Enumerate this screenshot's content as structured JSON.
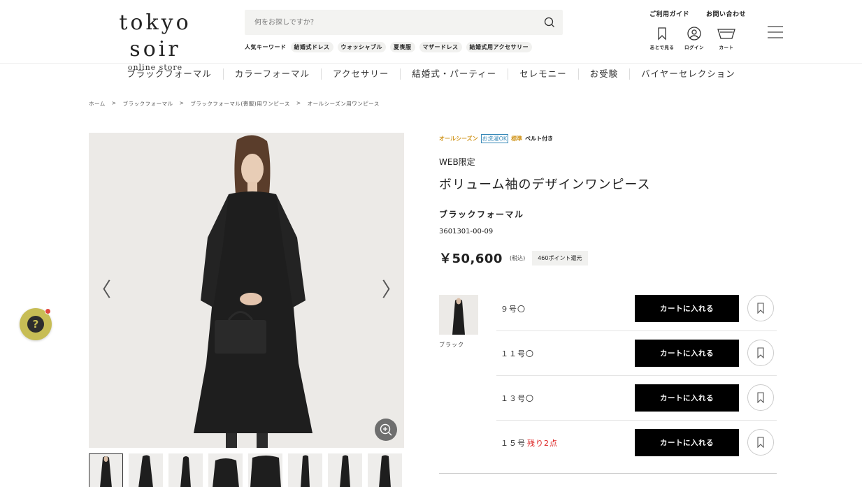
{
  "header": {
    "logo_main": "tokyo soir",
    "logo_sub": "online store",
    "search_placeholder": "何をお探しですか？",
    "keywords_label": "人気キーワード",
    "keywords": [
      "結婚式ドレス",
      "ウォッシャブル",
      "夏喪服",
      "マザードレス",
      "結婚式用アクセサリー"
    ],
    "guide_link": "ご利用ガイド",
    "contact_link": "お問い合わせ",
    "icons": [
      {
        "name": "bookmark-icon",
        "label": "あとで見る"
      },
      {
        "name": "user-icon",
        "label": "ログイン"
      },
      {
        "name": "cart-icon",
        "label": "カート"
      }
    ]
  },
  "nav": [
    "ブラックフォーマル",
    "カラーフォーマル",
    "アクセサリー",
    "結婚式・パーティー",
    "セレモニー",
    "お受験",
    "バイヤーセレクション"
  ],
  "breadcrumb": [
    "ホーム",
    ">",
    "ブラックフォーマル",
    ">",
    "ブラックフォーマル(喪服)用ワンピース",
    ">",
    "オールシーズン用ワンピース"
  ],
  "gallery": {
    "prev": "〈",
    "next": "〉",
    "thumb_count": 8
  },
  "product": {
    "tag_season": "オールシーズン",
    "tag_wash": "お洗濯OK",
    "tag_std": "標準",
    "tag_belt": "ベルト付き",
    "web_only": "WEB限定",
    "name": "ボリューム袖のデザインワンピース",
    "category": "ブラックフォーマル",
    "code": "3601301-00-09",
    "price": "￥50,600",
    "tax": "(税込)",
    "points": "460ポイント還元",
    "color": "ブラック",
    "sizes": [
      {
        "label": "９号〇",
        "stock": "",
        "cart": "カートに入れる"
      },
      {
        "label": "１１号〇",
        "stock": "",
        "cart": "カートに入れる"
      },
      {
        "label": "１３号〇",
        "stock": "",
        "cart": "カートに入れる"
      },
      {
        "label": "１５号",
        "stock": "残り2点",
        "cart": "カートに入れる"
      }
    ]
  },
  "help": {
    "icon": "question-icon",
    "symbol": "?"
  },
  "colors": {
    "accent_gold": "#d1961f",
    "wash_blue": "#3789b8",
    "stock_red": "#dd2222",
    "help_yellow": "#c7bd55"
  }
}
